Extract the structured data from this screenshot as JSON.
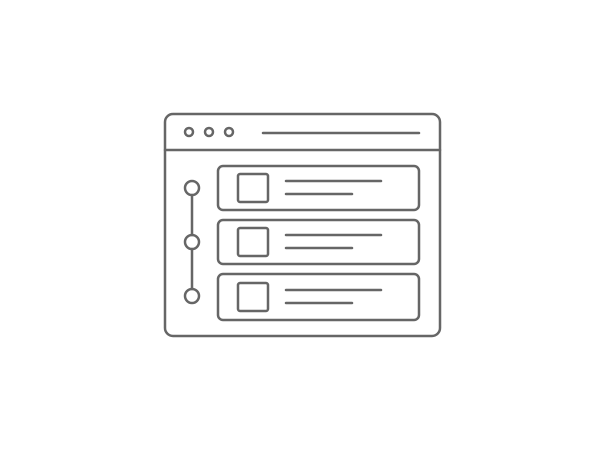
{
  "icon": {
    "name": "timeline-list-window-icon",
    "stroke_color": "#666666",
    "background_color": "#ffffff",
    "window_controls": [
      "dot",
      "dot",
      "dot"
    ],
    "items": [
      {
        "name": "list-item-1"
      },
      {
        "name": "list-item-2"
      },
      {
        "name": "list-item-3"
      }
    ]
  }
}
